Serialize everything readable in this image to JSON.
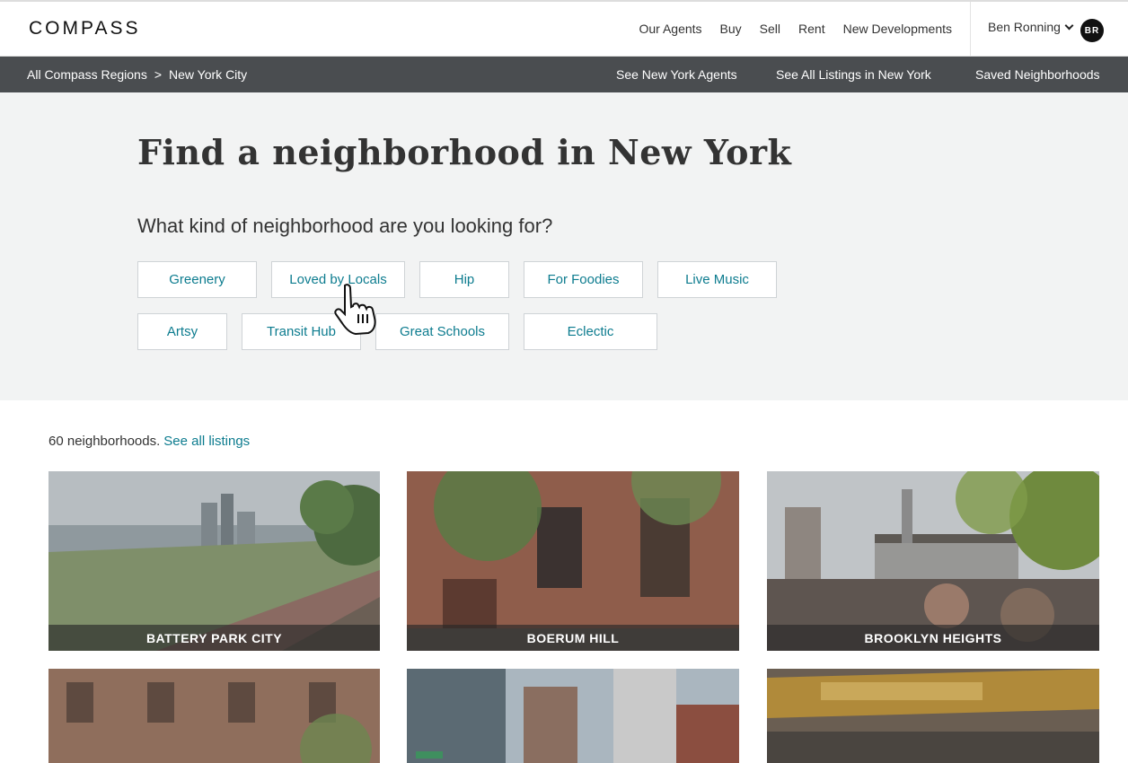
{
  "header": {
    "logo": "COMPASS",
    "nav": [
      "Our Agents",
      "Buy",
      "Sell",
      "Rent",
      "New Developments"
    ],
    "user_name": "Ben Ronning",
    "user_initials": "BR"
  },
  "subnav": {
    "breadcrumb": [
      "All Compass Regions",
      ">",
      "New York City"
    ],
    "links": [
      "See New York Agents",
      "See All Listings in New York",
      "Saved Neighborhoods"
    ]
  },
  "hero": {
    "title": "Find a neighborhood in New York",
    "question": "What kind of neighborhood are you looking for?",
    "tags": [
      "Greenery",
      "Loved by Locals",
      "Hip",
      "For Foodies",
      "Live Music",
      "Artsy",
      "Transit Hub",
      "Great Schools",
      "Eclectic"
    ]
  },
  "results": {
    "count_text": "60 neighborhoods.",
    "see_all": "See all listings"
  },
  "neighborhoods": [
    "BATTERY PARK CITY",
    "BOERUM HILL",
    "BROOKLYN HEIGHTS",
    "",
    "",
    ""
  ],
  "colors": {
    "accent": "#0d7c8f",
    "subnav_bg": "#4a4d50",
    "hero_bg": "#f2f3f3"
  }
}
